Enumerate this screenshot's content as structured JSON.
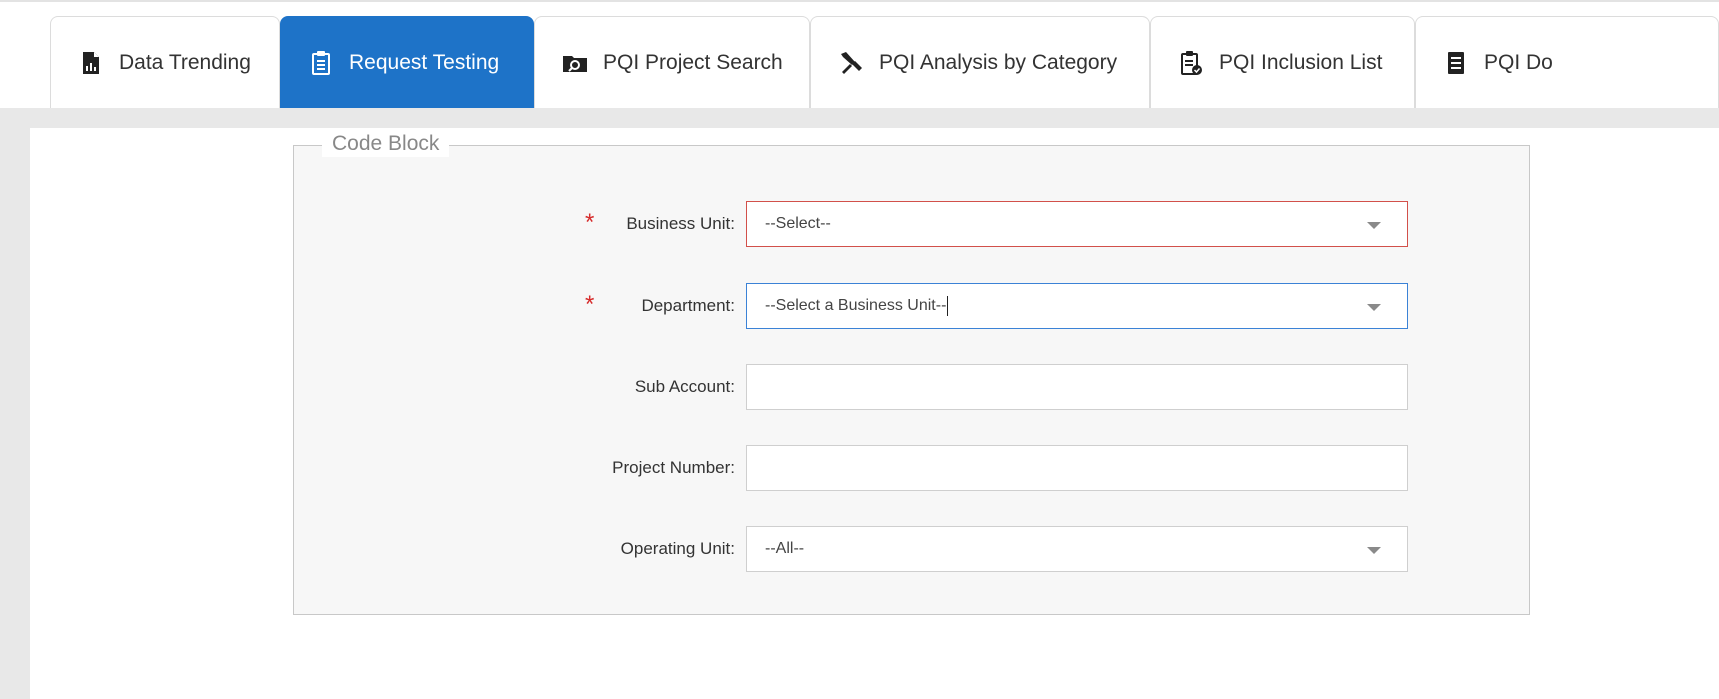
{
  "tabs": [
    {
      "label": "Data Trending",
      "icon": "report-icon",
      "active": false
    },
    {
      "label": "Request Testing",
      "icon": "clipboard-icon",
      "active": true
    },
    {
      "label": "PQI Project Search",
      "icon": "folder-search-icon",
      "active": false
    },
    {
      "label": "PQI Analysis by Category",
      "icon": "tools-icon",
      "active": false
    },
    {
      "label": "PQI Inclusion List",
      "icon": "clipboard-check-icon",
      "active": false
    },
    {
      "label": "PQI Do",
      "icon": "document-icon",
      "active": false
    }
  ],
  "code_block": {
    "legend": "Code Block",
    "fields": {
      "business_unit": {
        "label": "Business Unit:",
        "value": "--Select--",
        "required": true
      },
      "department": {
        "label": "Department:",
        "value": "--Select a Business Unit--",
        "required": true
      },
      "sub_account": {
        "label": "Sub Account:",
        "value": ""
      },
      "project_number": {
        "label": "Project Number:",
        "value": ""
      },
      "operating_unit": {
        "label": "Operating Unit:",
        "value": "--All--"
      }
    },
    "required_marker": "*"
  },
  "colors": {
    "active_tab": "#1e73c8",
    "error_border": "#d2504a",
    "focus_border": "#3b82d6",
    "required": "#d62b2b"
  }
}
